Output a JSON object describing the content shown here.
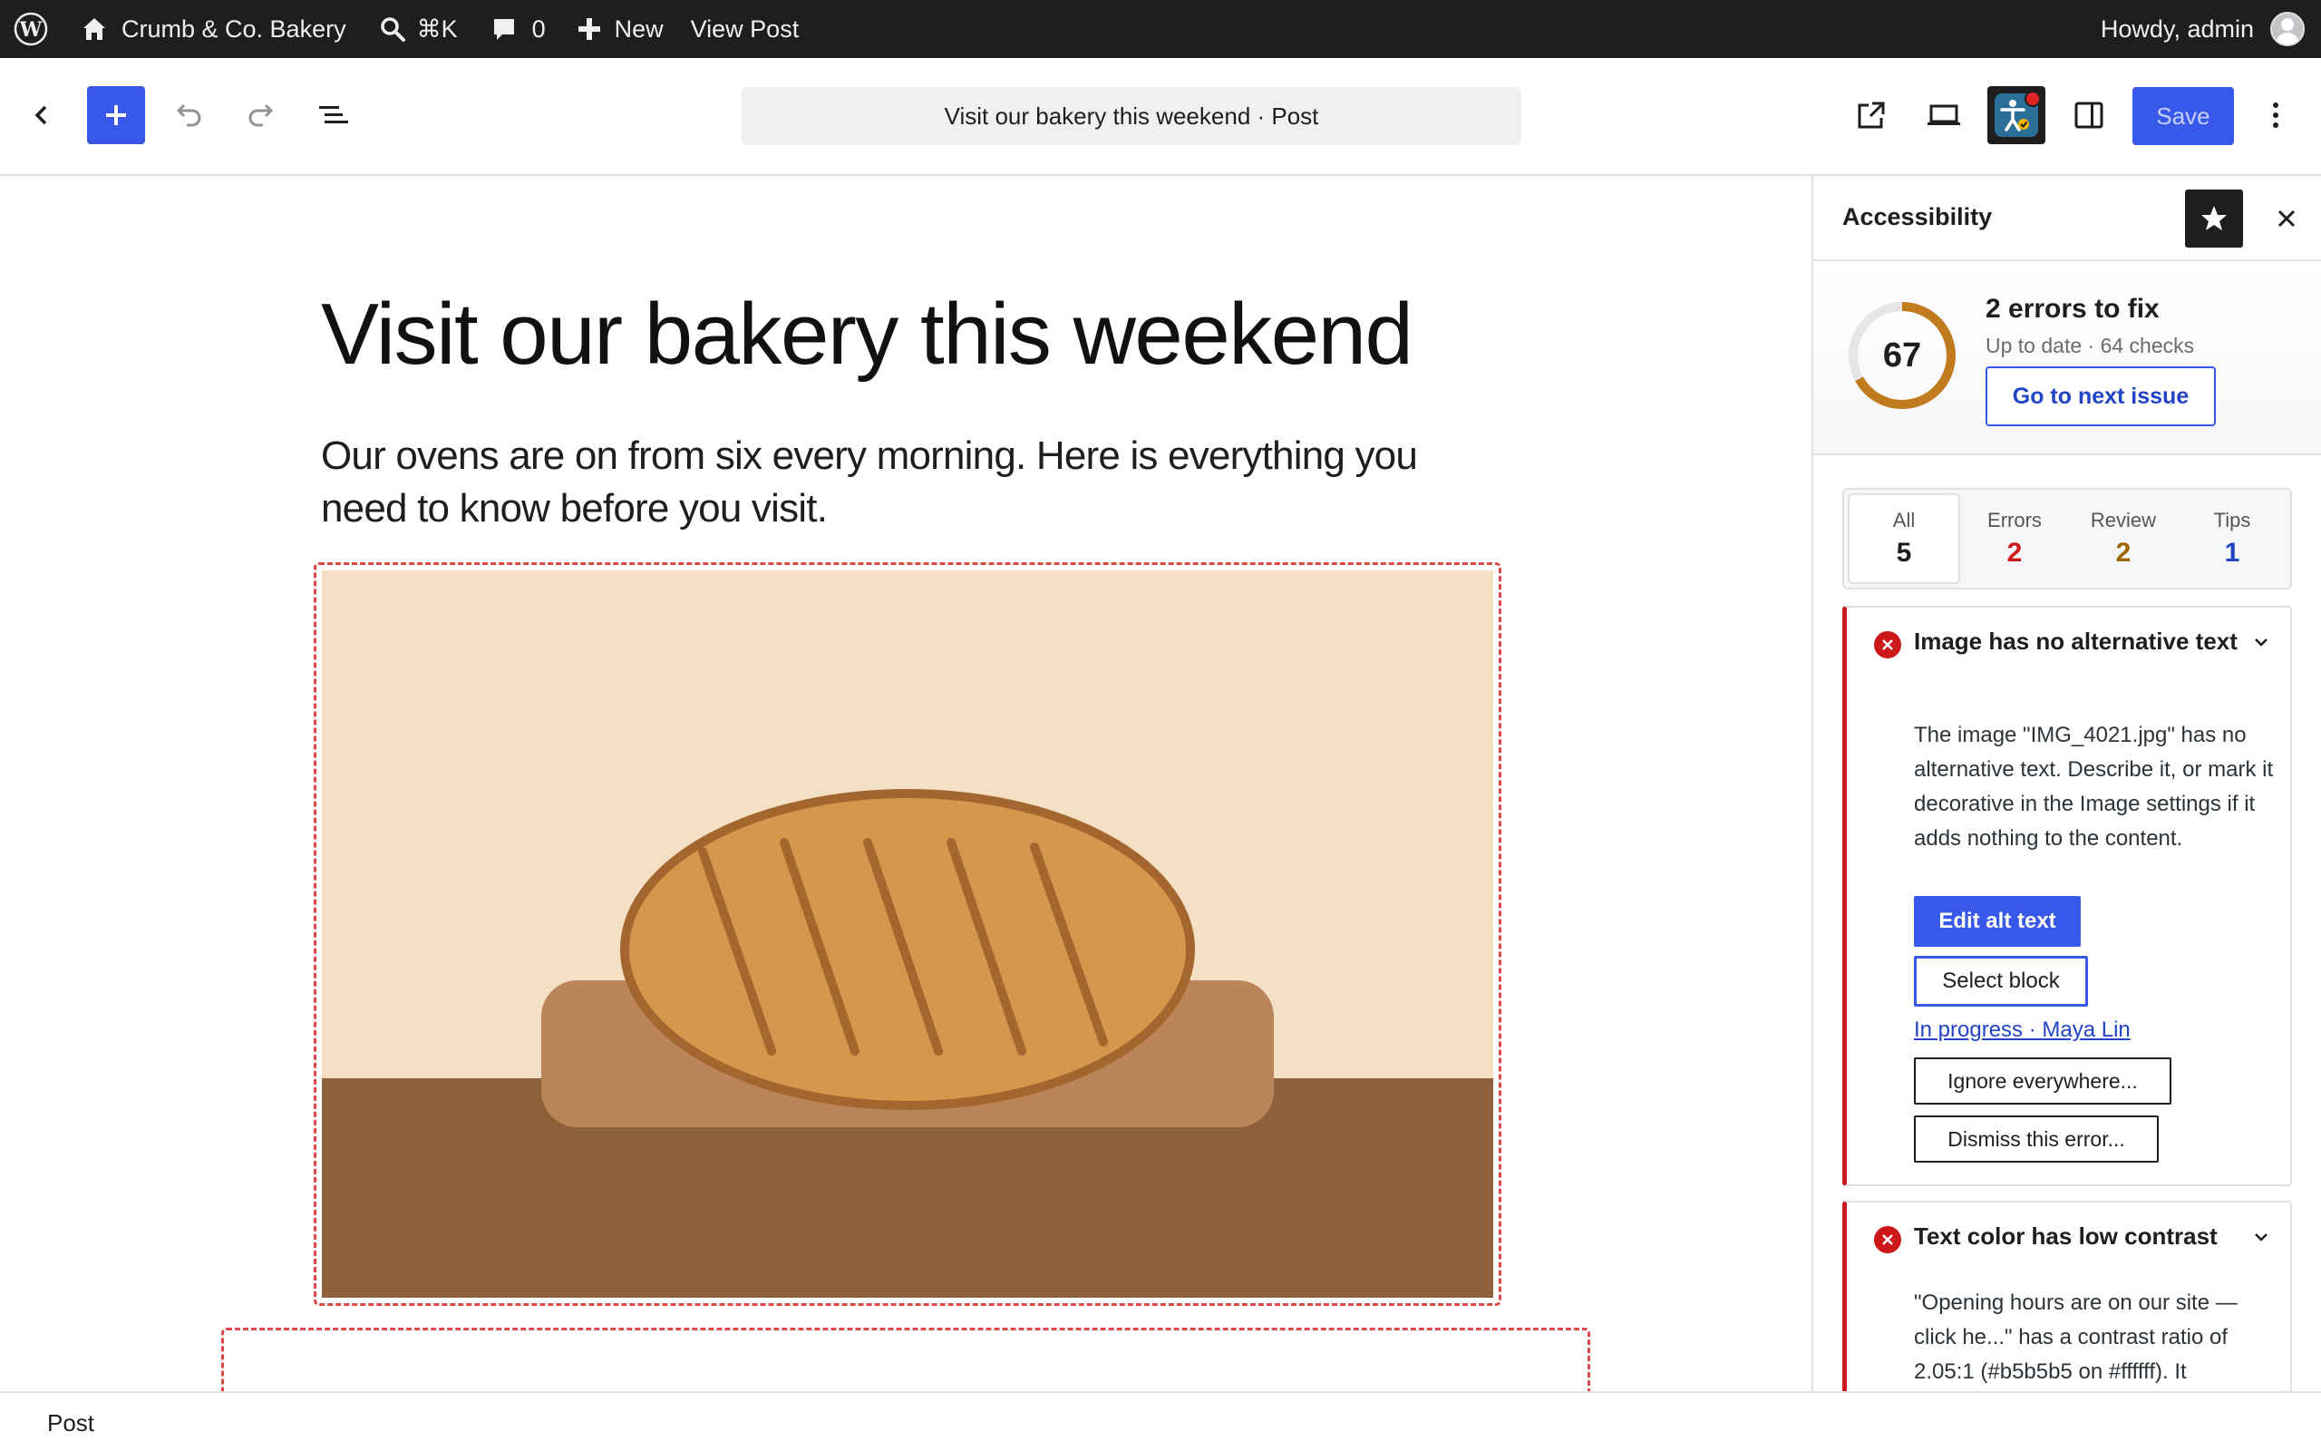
{
  "admin_bar": {
    "site_name": "Crumb & Co. Bakery",
    "search_shortcut": "⌘K",
    "comments_count": "0",
    "new_label": "New",
    "view_post_label": "View Post",
    "greeting": "Howdy, admin"
  },
  "header": {
    "document_title": "Visit our bakery this weekend · Post",
    "save_label": "Save"
  },
  "post": {
    "title": "Visit our bakery this weekend",
    "lead": "Our ovens are on from six every morning. Here is everything you need to know before you visit."
  },
  "sidebar": {
    "title": "Accessibility",
    "summary": {
      "score": "67",
      "score_fraction": 0.67,
      "title": "2 errors to fix",
      "subtitle": "Up to date · 64 checks",
      "next_issue_label": "Go to next issue"
    },
    "tabs": [
      {
        "label": "All",
        "count": "5",
        "color": "#1e1e1e"
      },
      {
        "label": "Errors",
        "count": "2",
        "color": "#cc1818"
      },
      {
        "label": "Review",
        "count": "2",
        "color": "#9a6700"
      },
      {
        "label": "Tips",
        "count": "1",
        "color": "#2145c4"
      }
    ],
    "issues": [
      {
        "title": "Image has no alternative text",
        "body": "The image \"IMG_4021.jpg\" has no alternative text. Describe it, or mark it decorative in the Image settings if it adds nothing to the content.",
        "primary_action": "Edit alt text",
        "select_action": "Select block",
        "status_link": "In progress · Maya Lin",
        "ignore_action": "Ignore everywhere...",
        "dismiss_action": "Dismiss this error..."
      },
      {
        "title": "Text color has low contrast",
        "body": "\"Opening hours are on our site — click he...\" has a contrast ratio of 2.05:1 (#b5b5b5 on #ffffff). It"
      }
    ]
  },
  "footer": {
    "breadcrumb": "Post"
  },
  "colors": {
    "accent": "#3858e9",
    "error": "#cc1818",
    "score_ring": "#c27a1e"
  }
}
